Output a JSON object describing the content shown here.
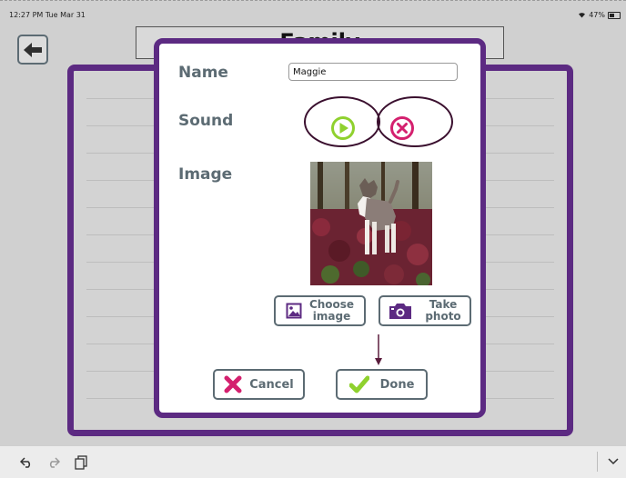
{
  "status_bar": {
    "time": "12:27 PM  Tue Mar 31",
    "wifi_icon": "wifi-icon",
    "battery": "47%"
  },
  "header": {
    "back_icon": "arrow-left-icon",
    "title": "Family"
  },
  "modal": {
    "name_label": "Name",
    "name_value": "Maggie",
    "sound_label": "Sound",
    "image_label": "Image",
    "choose_image_label": [
      "Choose",
      "image"
    ],
    "take_photo_label": [
      "Take",
      "photo"
    ],
    "cancel_label": "Cancel",
    "done_label": "Done",
    "icons": {
      "play": "play-icon",
      "delete": "delete-icon",
      "image": "image-icon",
      "camera": "camera-icon",
      "cancel": "x-icon",
      "done": "check-icon"
    }
  },
  "colors": {
    "frame_purple": "#5c2a82",
    "label_gray": "#5c6b73",
    "play_green": "#8fd12e",
    "delete_pink": "#d4206e",
    "annotation": "#3a0f2e"
  }
}
